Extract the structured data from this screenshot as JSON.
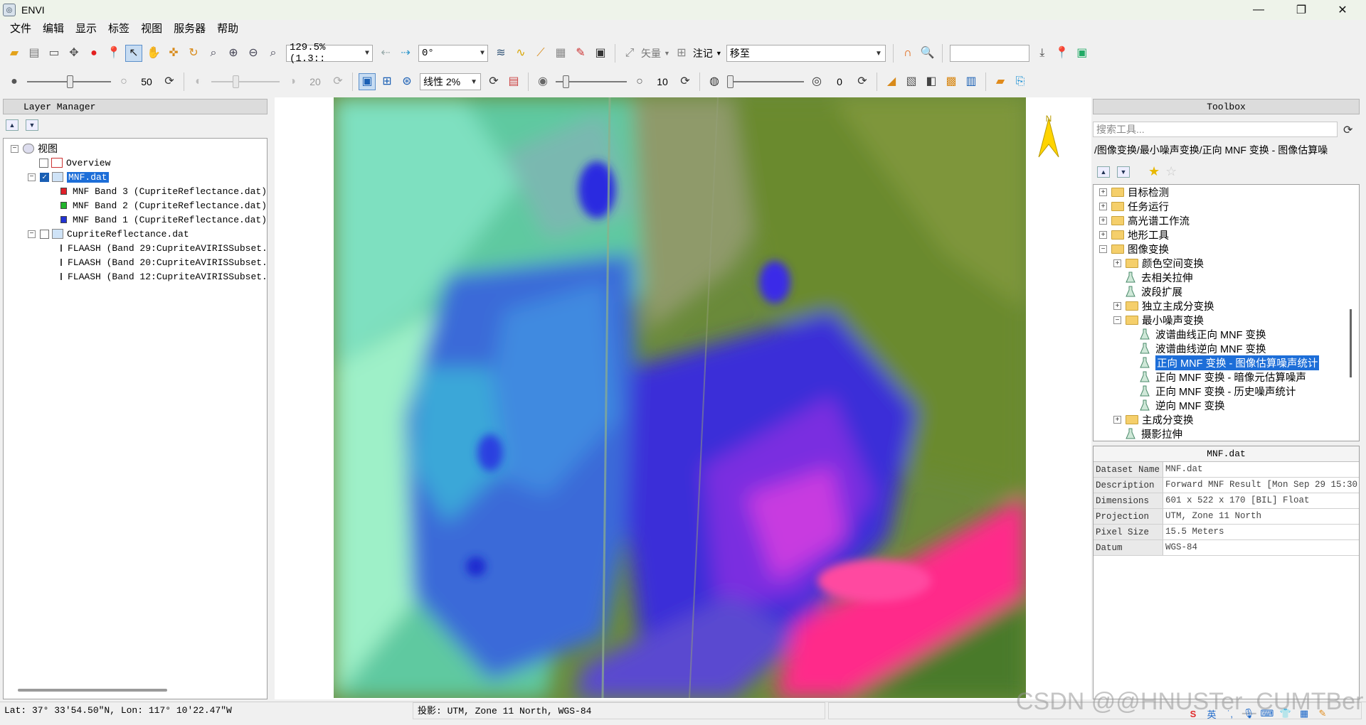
{
  "window": {
    "title": "ENVI"
  },
  "window_controls": {
    "minimize": "—",
    "restore": "❐",
    "close": "✕"
  },
  "menu": [
    "文件",
    "编辑",
    "显示",
    "标签",
    "视图",
    "服务器",
    "帮助"
  ],
  "toolbar1": {
    "zoom_value": "129.5% (1.3:: ",
    "rotation_value": "0°",
    "vector_label": "矢量",
    "annotation_label": "注记",
    "goto_value": "移至"
  },
  "toolbar2": {
    "brightness_value": "50",
    "contrast_value": "20",
    "stretch_value": "线性 2%",
    "sharpen_value": "10",
    "transparency_value": "0"
  },
  "layer_manager": {
    "title": "Layer Manager",
    "root": "视图",
    "overview": "Overview",
    "layers": [
      {
        "name": "MNF.dat",
        "checked": true,
        "selected": true,
        "bands": [
          {
            "label": "MNF Band 3 (CupriteReflectance.dat)",
            "color": "#e0202a"
          },
          {
            "label": "MNF Band 2 (CupriteReflectance.dat)",
            "color": "#21b52b"
          },
          {
            "label": "MNF Band 1 (CupriteReflectance.dat)",
            "color": "#2233d4"
          }
        ]
      },
      {
        "name": "CupriteReflectance.dat",
        "checked": false,
        "selected": false,
        "bands": [
          {
            "label": "FLAASH (Band 29:CupriteAVIRISSubset.",
            "color": "#e0202a"
          },
          {
            "label": "FLAASH (Band 20:CupriteAVIRISSubset.",
            "color": "#21b52b"
          },
          {
            "label": "FLAASH (Band 12:CupriteAVIRISSubset.",
            "color": "#2233d4"
          }
        ]
      }
    ]
  },
  "toolbox": {
    "title": "Toolbox",
    "search_placeholder": "搜索工具...",
    "path": "/图像变换/最小噪声变换/正向 MNF 变换 - 图像估算噪",
    "tree": [
      {
        "label": "目标检测",
        "type": "folder",
        "level": 0,
        "expander": "+"
      },
      {
        "label": "任务运行",
        "type": "folder",
        "level": 0,
        "expander": "+"
      },
      {
        "label": "高光谱工作流",
        "type": "folder",
        "level": 0,
        "expander": "+"
      },
      {
        "label": "地形工具",
        "type": "folder",
        "level": 0,
        "expander": "+"
      },
      {
        "label": "图像变换",
        "type": "folder",
        "level": 0,
        "expander": "-"
      },
      {
        "label": "颜色空间变换",
        "type": "folder",
        "level": 1,
        "expander": "+"
      },
      {
        "label": "去相关拉伸",
        "type": "tool",
        "level": 1,
        "expander": ""
      },
      {
        "label": "波段扩展",
        "type": "tool",
        "level": 1,
        "expander": ""
      },
      {
        "label": "独立主成分变换",
        "type": "folder",
        "level": 1,
        "expander": "+"
      },
      {
        "label": "最小噪声变换",
        "type": "folder",
        "level": 1,
        "expander": "-"
      },
      {
        "label": "波谱曲线正向 MNF 变换",
        "type": "tool",
        "level": 2,
        "expander": ""
      },
      {
        "label": "波谱曲线逆向 MNF 变换",
        "type": "tool",
        "level": 2,
        "expander": ""
      },
      {
        "label": "正向 MNF 变换 - 图像估算噪声统计",
        "type": "tool",
        "level": 2,
        "expander": "",
        "selected": true
      },
      {
        "label": "正向 MNF 变换 - 暗像元估算噪声",
        "type": "tool",
        "level": 2,
        "expander": ""
      },
      {
        "label": "正向 MNF 变换 - 历史噪声统计",
        "type": "tool",
        "level": 2,
        "expander": ""
      },
      {
        "label": "逆向 MNF 变换",
        "type": "tool",
        "level": 2,
        "expander": ""
      },
      {
        "label": "主成分变换",
        "type": "folder",
        "level": 1,
        "expander": "+"
      },
      {
        "label": "摄影拉伸",
        "type": "tool",
        "level": 1,
        "expander": ""
      }
    ]
  },
  "properties": {
    "title": "MNF.dat",
    "rows": [
      {
        "key": "Dataset Name",
        "value": "MNF.dat"
      },
      {
        "key": "Description",
        "value": "Forward MNF Result [Mon Sep 29 15:30"
      },
      {
        "key": "Dimensions",
        "value": "601 x 522 x 170 [BIL] Float"
      },
      {
        "key": "Projection",
        "value": "UTM, Zone 11 North"
      },
      {
        "key": "Pixel Size",
        "value": "15.5 Meters"
      },
      {
        "key": "Datum",
        "value": "WGS-84"
      }
    ]
  },
  "status": {
    "coords": "Lat: 37° 33′54.50″N, Lon: 117° 10′22.47″W",
    "projection": "投影:  UTM, Zone 11 North, WGS-84"
  },
  "watermark": "CSDN @@HNUSTer_CUMTBer",
  "tray": {
    "ime": "英"
  },
  "colors": {
    "selection": "#1d6ed8",
    "accent": "#ffcc00"
  }
}
